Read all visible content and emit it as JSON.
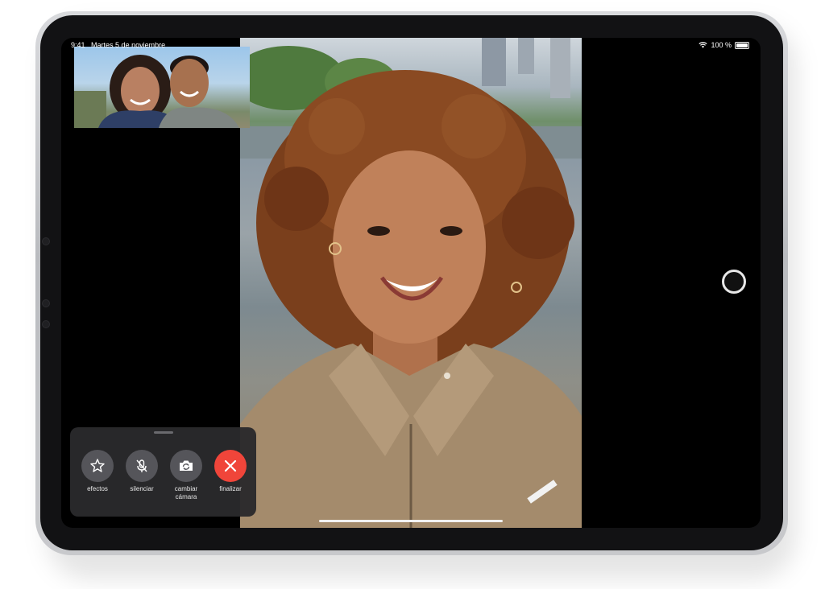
{
  "status_bar": {
    "time": "9:41",
    "date": "Martes 5 de noviembre",
    "battery": "100 %"
  },
  "call_controls": [
    {
      "id": "effects",
      "label": "efectos",
      "icon": "star-effects-icon"
    },
    {
      "id": "mute",
      "label": "silenciar",
      "icon": "mic-slash-icon"
    },
    {
      "id": "flip",
      "label": "cambiar cámara",
      "icon": "camera-rotate-icon"
    },
    {
      "id": "end",
      "label": "finalizar",
      "icon": "close-x-icon",
      "color": "#f0453a"
    }
  ],
  "colors": {
    "end_call": "#f0453a",
    "control_panel": "#2a2a2c",
    "device_frame": "#c8c9cc"
  }
}
